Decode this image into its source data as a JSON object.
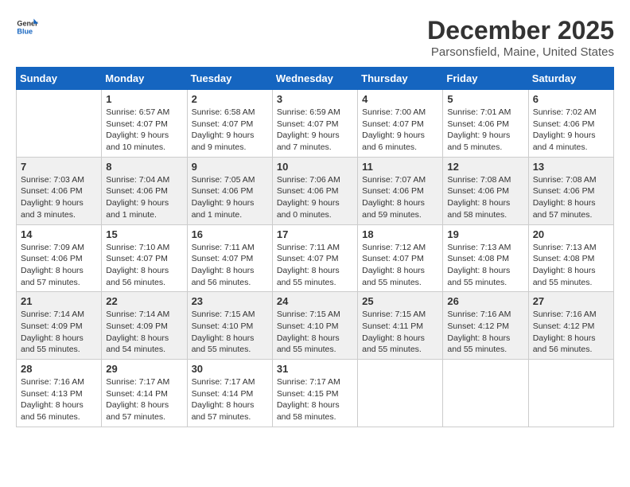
{
  "header": {
    "logo_general": "General",
    "logo_blue": "Blue",
    "month": "December 2025",
    "location": "Parsonsfield, Maine, United States"
  },
  "weekdays": [
    "Sunday",
    "Monday",
    "Tuesday",
    "Wednesday",
    "Thursday",
    "Friday",
    "Saturday"
  ],
  "weeks": [
    [
      {
        "day": "",
        "info": ""
      },
      {
        "day": "1",
        "info": "Sunrise: 6:57 AM\nSunset: 4:07 PM\nDaylight: 9 hours\nand 10 minutes."
      },
      {
        "day": "2",
        "info": "Sunrise: 6:58 AM\nSunset: 4:07 PM\nDaylight: 9 hours\nand 9 minutes."
      },
      {
        "day": "3",
        "info": "Sunrise: 6:59 AM\nSunset: 4:07 PM\nDaylight: 9 hours\nand 7 minutes."
      },
      {
        "day": "4",
        "info": "Sunrise: 7:00 AM\nSunset: 4:07 PM\nDaylight: 9 hours\nand 6 minutes."
      },
      {
        "day": "5",
        "info": "Sunrise: 7:01 AM\nSunset: 4:06 PM\nDaylight: 9 hours\nand 5 minutes."
      },
      {
        "day": "6",
        "info": "Sunrise: 7:02 AM\nSunset: 4:06 PM\nDaylight: 9 hours\nand 4 minutes."
      }
    ],
    [
      {
        "day": "7",
        "info": "Sunrise: 7:03 AM\nSunset: 4:06 PM\nDaylight: 9 hours\nand 3 minutes."
      },
      {
        "day": "8",
        "info": "Sunrise: 7:04 AM\nSunset: 4:06 PM\nDaylight: 9 hours\nand 1 minute."
      },
      {
        "day": "9",
        "info": "Sunrise: 7:05 AM\nSunset: 4:06 PM\nDaylight: 9 hours\nand 1 minute."
      },
      {
        "day": "10",
        "info": "Sunrise: 7:06 AM\nSunset: 4:06 PM\nDaylight: 9 hours\nand 0 minutes."
      },
      {
        "day": "11",
        "info": "Sunrise: 7:07 AM\nSunset: 4:06 PM\nDaylight: 8 hours\nand 59 minutes."
      },
      {
        "day": "12",
        "info": "Sunrise: 7:08 AM\nSunset: 4:06 PM\nDaylight: 8 hours\nand 58 minutes."
      },
      {
        "day": "13",
        "info": "Sunrise: 7:08 AM\nSunset: 4:06 PM\nDaylight: 8 hours\nand 57 minutes."
      }
    ],
    [
      {
        "day": "14",
        "info": "Sunrise: 7:09 AM\nSunset: 4:06 PM\nDaylight: 8 hours\nand 57 minutes."
      },
      {
        "day": "15",
        "info": "Sunrise: 7:10 AM\nSunset: 4:07 PM\nDaylight: 8 hours\nand 56 minutes."
      },
      {
        "day": "16",
        "info": "Sunrise: 7:11 AM\nSunset: 4:07 PM\nDaylight: 8 hours\nand 56 minutes."
      },
      {
        "day": "17",
        "info": "Sunrise: 7:11 AM\nSunset: 4:07 PM\nDaylight: 8 hours\nand 55 minutes."
      },
      {
        "day": "18",
        "info": "Sunrise: 7:12 AM\nSunset: 4:07 PM\nDaylight: 8 hours\nand 55 minutes."
      },
      {
        "day": "19",
        "info": "Sunrise: 7:13 AM\nSunset: 4:08 PM\nDaylight: 8 hours\nand 55 minutes."
      },
      {
        "day": "20",
        "info": "Sunrise: 7:13 AM\nSunset: 4:08 PM\nDaylight: 8 hours\nand 55 minutes."
      }
    ],
    [
      {
        "day": "21",
        "info": "Sunrise: 7:14 AM\nSunset: 4:09 PM\nDaylight: 8 hours\nand 55 minutes."
      },
      {
        "day": "22",
        "info": "Sunrise: 7:14 AM\nSunset: 4:09 PM\nDaylight: 8 hours\nand 54 minutes."
      },
      {
        "day": "23",
        "info": "Sunrise: 7:15 AM\nSunset: 4:10 PM\nDaylight: 8 hours\nand 55 minutes."
      },
      {
        "day": "24",
        "info": "Sunrise: 7:15 AM\nSunset: 4:10 PM\nDaylight: 8 hours\nand 55 minutes."
      },
      {
        "day": "25",
        "info": "Sunrise: 7:15 AM\nSunset: 4:11 PM\nDaylight: 8 hours\nand 55 minutes."
      },
      {
        "day": "26",
        "info": "Sunrise: 7:16 AM\nSunset: 4:12 PM\nDaylight: 8 hours\nand 55 minutes."
      },
      {
        "day": "27",
        "info": "Sunrise: 7:16 AM\nSunset: 4:12 PM\nDaylight: 8 hours\nand 56 minutes."
      }
    ],
    [
      {
        "day": "28",
        "info": "Sunrise: 7:16 AM\nSunset: 4:13 PM\nDaylight: 8 hours\nand 56 minutes."
      },
      {
        "day": "29",
        "info": "Sunrise: 7:17 AM\nSunset: 4:14 PM\nDaylight: 8 hours\nand 57 minutes."
      },
      {
        "day": "30",
        "info": "Sunrise: 7:17 AM\nSunset: 4:14 PM\nDaylight: 8 hours\nand 57 minutes."
      },
      {
        "day": "31",
        "info": "Sunrise: 7:17 AM\nSunset: 4:15 PM\nDaylight: 8 hours\nand 58 minutes."
      },
      {
        "day": "",
        "info": ""
      },
      {
        "day": "",
        "info": ""
      },
      {
        "day": "",
        "info": ""
      }
    ]
  ]
}
